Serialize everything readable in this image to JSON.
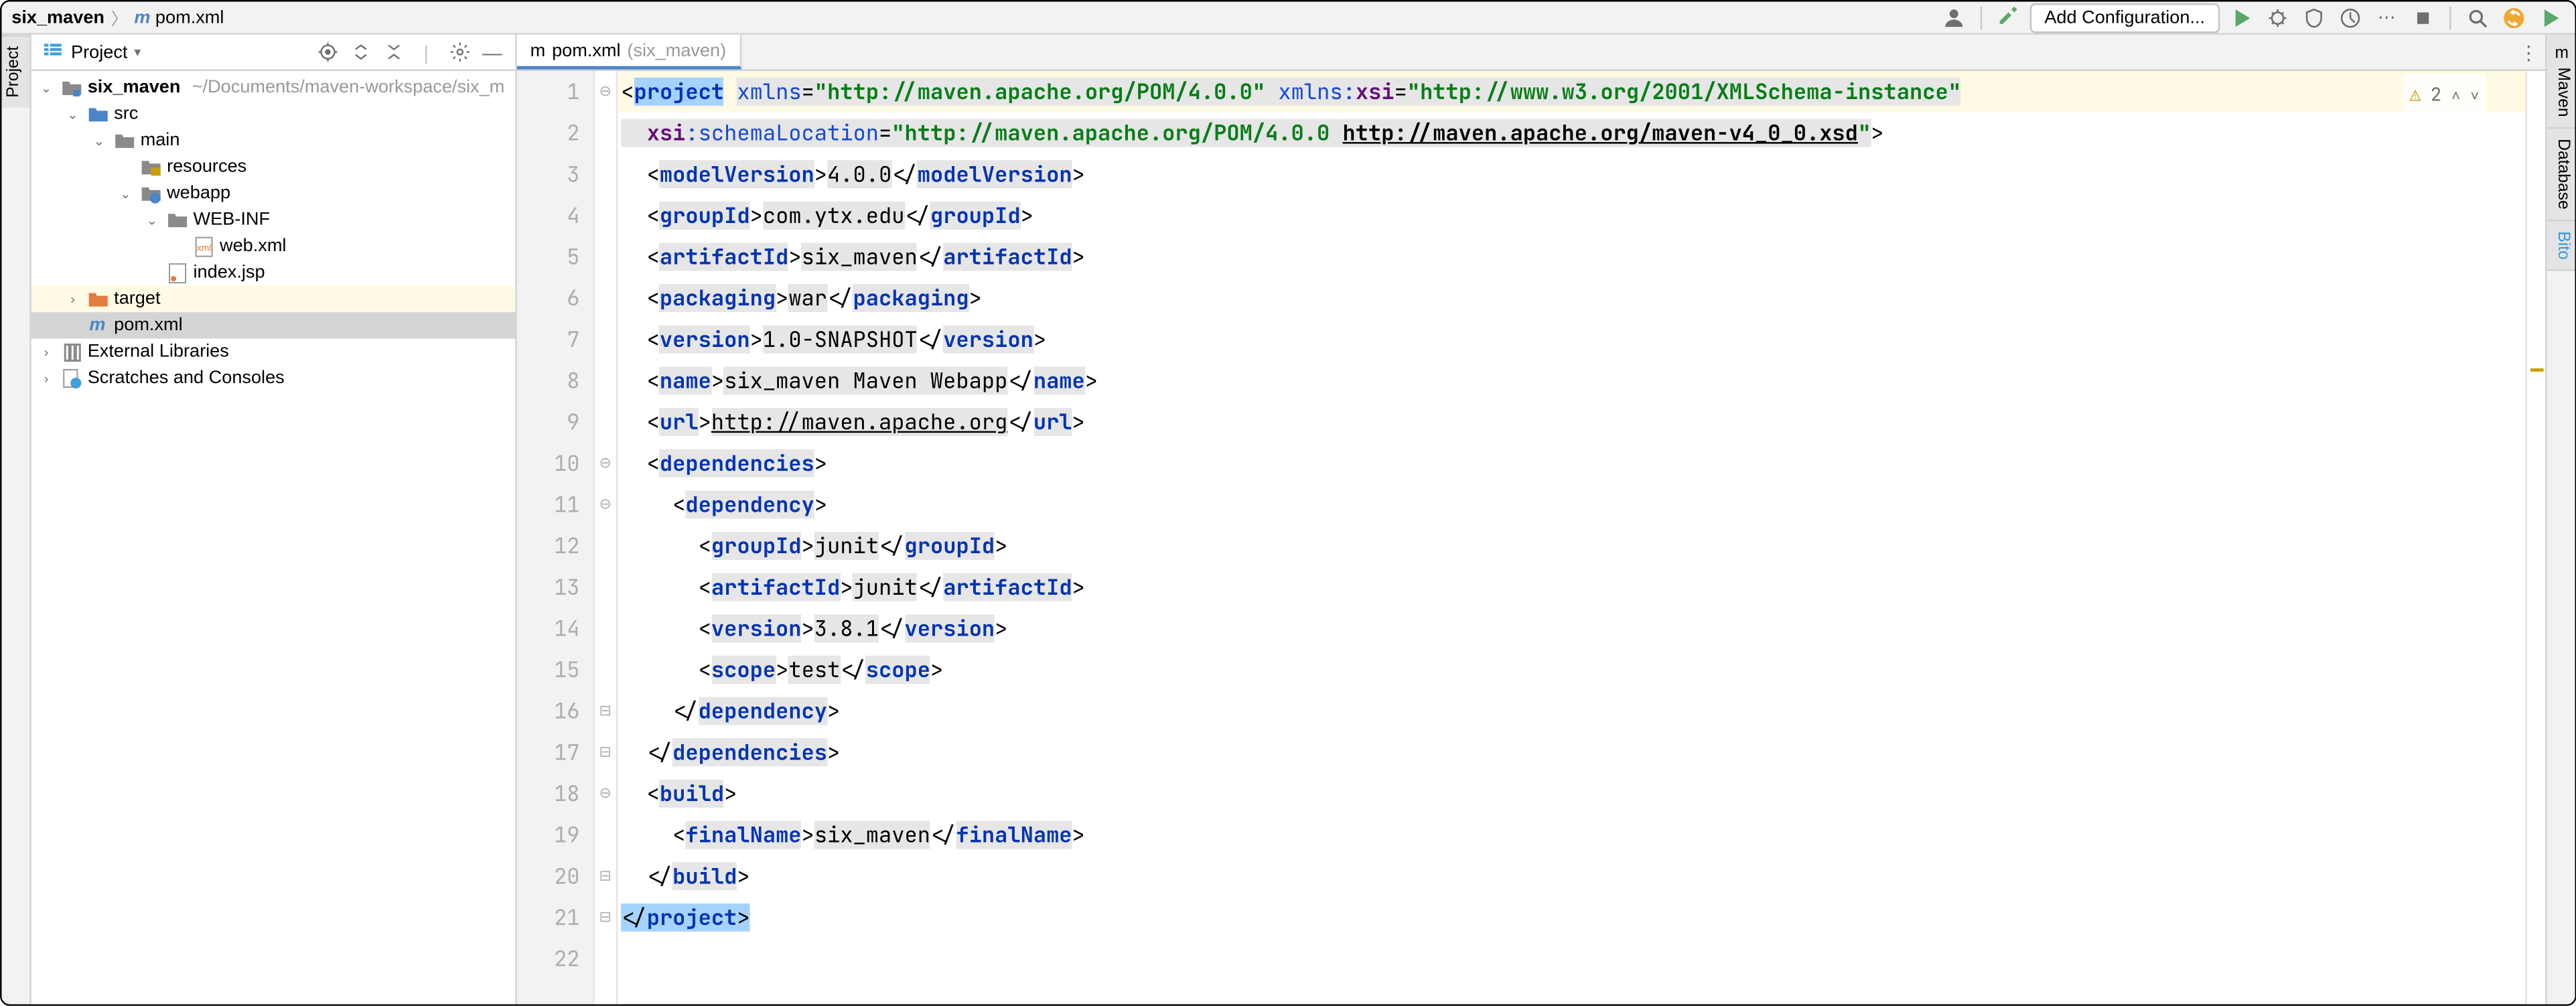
{
  "breadcrumbs": [
    {
      "label": "six_maven",
      "icon": "module",
      "bold": true
    },
    {
      "label": "pom.xml",
      "icon": "m"
    }
  ],
  "toolbar": {
    "add_config": "Add Configuration..."
  },
  "rails": {
    "left": "Project",
    "right": [
      "Maven",
      "Database",
      "Bito"
    ]
  },
  "project_header": {
    "title": "Project"
  },
  "tree": [
    {
      "d": 0,
      "arrow": "down",
      "icon": "module",
      "label": "six_maven",
      "bold": true,
      "path": "~/Documents/maven-workspace/six_m"
    },
    {
      "d": 1,
      "arrow": "down",
      "icon": "folder-src",
      "label": "src"
    },
    {
      "d": 2,
      "arrow": "down",
      "icon": "folder",
      "label": "main"
    },
    {
      "d": 3,
      "arrow": "none",
      "icon": "folder-res",
      "label": "resources"
    },
    {
      "d": 3,
      "arrow": "down",
      "icon": "folder-web",
      "label": "webapp"
    },
    {
      "d": 4,
      "arrow": "down",
      "icon": "folder",
      "label": "WEB-INF"
    },
    {
      "d": 5,
      "arrow": "none",
      "icon": "xml",
      "label": "web.xml"
    },
    {
      "d": 4,
      "arrow": "none",
      "icon": "jsp",
      "label": "index.jsp"
    },
    {
      "d": 1,
      "arrow": "right",
      "icon": "folder-tgt",
      "label": "target",
      "hl": true
    },
    {
      "d": 1,
      "arrow": "none",
      "icon": "m",
      "label": "pom.xml",
      "sel": true
    },
    {
      "d": 0,
      "arrow": "right",
      "icon": "lib",
      "label": "External Libraries"
    },
    {
      "d": 0,
      "arrow": "right",
      "icon": "scratch",
      "label": "Scratches and Consoles"
    }
  ],
  "tab": {
    "icon": "m",
    "label": "pom.xml",
    "sub": "(six_maven)"
  },
  "inspections": {
    "warnings": 2
  },
  "code": {
    "lines": 22,
    "src": [
      [
        [
          "<",
          "p"
        ],
        [
          "project",
          "tag sel"
        ],
        [
          " ",
          "p"
        ],
        [
          "xmlns",
          "attr bg"
        ],
        [
          "=",
          "p bg"
        ],
        [
          "\"http://maven.apache.org/POM/4.0.0\"",
          "val bg"
        ],
        [
          " ",
          "p bg"
        ],
        [
          "xmlns:",
          "attr bg"
        ],
        [
          "xsi",
          "ns bg"
        ],
        [
          "=",
          "p bg"
        ],
        [
          "\"http://www.w3.org/2001/XMLSchema-instance\"",
          "val bg"
        ]
      ],
      [
        [
          "  ",
          "p bg"
        ],
        [
          "xsi",
          "ns bg"
        ],
        [
          ":schemaLocation",
          "attr bg"
        ],
        [
          "=",
          "p bg"
        ],
        [
          "\"http://maven.apache.org/POM/4.0.0 ",
          "val bg"
        ],
        [
          "http://maven.apache.org/maven-v4_0_0.xsd",
          "val bg url"
        ],
        [
          "\"",
          "val bg"
        ],
        [
          ">",
          "p"
        ]
      ],
      [
        [
          "  <",
          "p"
        ],
        [
          "modelVersion",
          "tag bg"
        ],
        [
          ">",
          "p"
        ],
        [
          "4.0.0",
          "txt bg"
        ],
        [
          "</",
          "p"
        ],
        [
          "modelVersion",
          "tag bg"
        ],
        [
          ">",
          "p"
        ]
      ],
      [
        [
          "  <",
          "p"
        ],
        [
          "groupId",
          "tag bg"
        ],
        [
          ">",
          "p"
        ],
        [
          "com.ytx.edu",
          "txt bg"
        ],
        [
          "</",
          "p"
        ],
        [
          "groupId",
          "tag bg"
        ],
        [
          ">",
          "p"
        ]
      ],
      [
        [
          "  <",
          "p"
        ],
        [
          "artifactId",
          "tag bg"
        ],
        [
          ">",
          "p"
        ],
        [
          "six_maven",
          "txt bg"
        ],
        [
          "</",
          "p"
        ],
        [
          "artifactId",
          "tag bg"
        ],
        [
          ">",
          "p"
        ]
      ],
      [
        [
          "  <",
          "p"
        ],
        [
          "packaging",
          "tag bg"
        ],
        [
          ">",
          "p"
        ],
        [
          "war",
          "txt bg"
        ],
        [
          "</",
          "p"
        ],
        [
          "packaging",
          "tag bg"
        ],
        [
          ">",
          "p"
        ]
      ],
      [
        [
          "  <",
          "p"
        ],
        [
          "version",
          "tag bg"
        ],
        [
          ">",
          "p"
        ],
        [
          "1.0-SNAPSHOT",
          "txt bg"
        ],
        [
          "</",
          "p"
        ],
        [
          "version",
          "tag bg"
        ],
        [
          ">",
          "p"
        ]
      ],
      [
        [
          "  <",
          "p"
        ],
        [
          "name",
          "tag bg"
        ],
        [
          ">",
          "p"
        ],
        [
          "six_maven Maven Webapp",
          "txt bg"
        ],
        [
          "</",
          "p"
        ],
        [
          "name",
          "tag bg"
        ],
        [
          ">",
          "p"
        ]
      ],
      [
        [
          "  <",
          "p"
        ],
        [
          "url",
          "tag bg"
        ],
        [
          ">",
          "p"
        ],
        [
          "http://maven.apache.org",
          "txt bg url"
        ],
        [
          "</",
          "p"
        ],
        [
          "url",
          "tag bg"
        ],
        [
          ">",
          "p"
        ]
      ],
      [
        [
          "  <",
          "p"
        ],
        [
          "dependencies",
          "tag bg"
        ],
        [
          ">",
          "p"
        ]
      ],
      [
        [
          "    <",
          "p"
        ],
        [
          "dependency",
          "tag bg"
        ],
        [
          ">",
          "p"
        ]
      ],
      [
        [
          "      <",
          "p"
        ],
        [
          "groupId",
          "tag bg"
        ],
        [
          ">",
          "p"
        ],
        [
          "junit",
          "txt bg"
        ],
        [
          "</",
          "p"
        ],
        [
          "groupId",
          "tag bg"
        ],
        [
          ">",
          "p"
        ]
      ],
      [
        [
          "      <",
          "p"
        ],
        [
          "artifactId",
          "tag bg"
        ],
        [
          ">",
          "p"
        ],
        [
          "junit",
          "txt bg"
        ],
        [
          "</",
          "p"
        ],
        [
          "artifactId",
          "tag bg"
        ],
        [
          ">",
          "p"
        ]
      ],
      [
        [
          "      <",
          "p"
        ],
        [
          "version",
          "tag bg"
        ],
        [
          ">",
          "p"
        ],
        [
          "3.8.1",
          "txt bg"
        ],
        [
          "</",
          "p"
        ],
        [
          "version",
          "tag bg"
        ],
        [
          ">",
          "p"
        ]
      ],
      [
        [
          "      <",
          "p"
        ],
        [
          "scope",
          "tag bg"
        ],
        [
          ">",
          "p"
        ],
        [
          "test",
          "txt bg"
        ],
        [
          "</",
          "p"
        ],
        [
          "scope",
          "tag bg"
        ],
        [
          ">",
          "p"
        ]
      ],
      [
        [
          "    </",
          "p"
        ],
        [
          "dependency",
          "tag bg"
        ],
        [
          ">",
          "p"
        ]
      ],
      [
        [
          "  </",
          "p"
        ],
        [
          "dependencies",
          "tag bg"
        ],
        [
          ">",
          "p"
        ]
      ],
      [
        [
          "  <",
          "p"
        ],
        [
          "build",
          "tag bg"
        ],
        [
          ">",
          "p"
        ]
      ],
      [
        [
          "    <",
          "p"
        ],
        [
          "finalName",
          "tag bg"
        ],
        [
          ">",
          "p"
        ],
        [
          "six_maven",
          "txt bg"
        ],
        [
          "</",
          "p"
        ],
        [
          "finalName",
          "tag bg"
        ],
        [
          ">",
          "p"
        ]
      ],
      [
        [
          "  </",
          "p"
        ],
        [
          "build",
          "tag bg"
        ],
        [
          ">",
          "p"
        ]
      ],
      [
        [
          "</",
          "p sel2"
        ],
        [
          "project",
          "tag sel2"
        ],
        [
          ">",
          "p sel2"
        ]
      ],
      []
    ]
  }
}
